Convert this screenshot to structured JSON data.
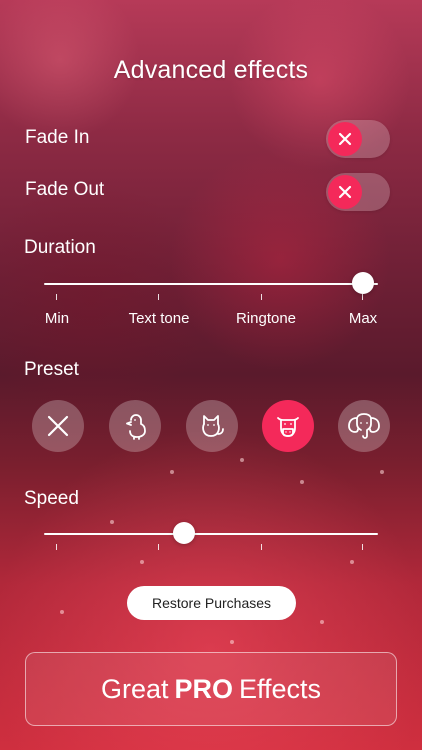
{
  "screen": {
    "title": "Advanced effects"
  },
  "fade": {
    "fade_in_label": "Fade In",
    "fade_in_enabled": true,
    "fade_out_label": "Fade Out",
    "fade_out_enabled": true
  },
  "duration": {
    "label": "Duration",
    "ticks": [
      "Min",
      "Text tone",
      "Ringtone",
      "Max"
    ],
    "selected_index": 3
  },
  "preset": {
    "label": "Preset",
    "items": [
      {
        "icon": "none-x-icon",
        "active": false
      },
      {
        "icon": "chick-icon",
        "active": false
      },
      {
        "icon": "cat-icon",
        "active": false
      },
      {
        "icon": "cow-icon",
        "active": true
      },
      {
        "icon": "elephant-icon",
        "active": false
      }
    ]
  },
  "speed": {
    "label": "Speed",
    "level": 0.42
  },
  "purchase": {
    "restore_label": "Restore Purchases",
    "pro_prefix": "Great",
    "pro_bold": "PRO",
    "pro_suffix": "Effects"
  },
  "colors": {
    "accent": "#f4295a"
  }
}
